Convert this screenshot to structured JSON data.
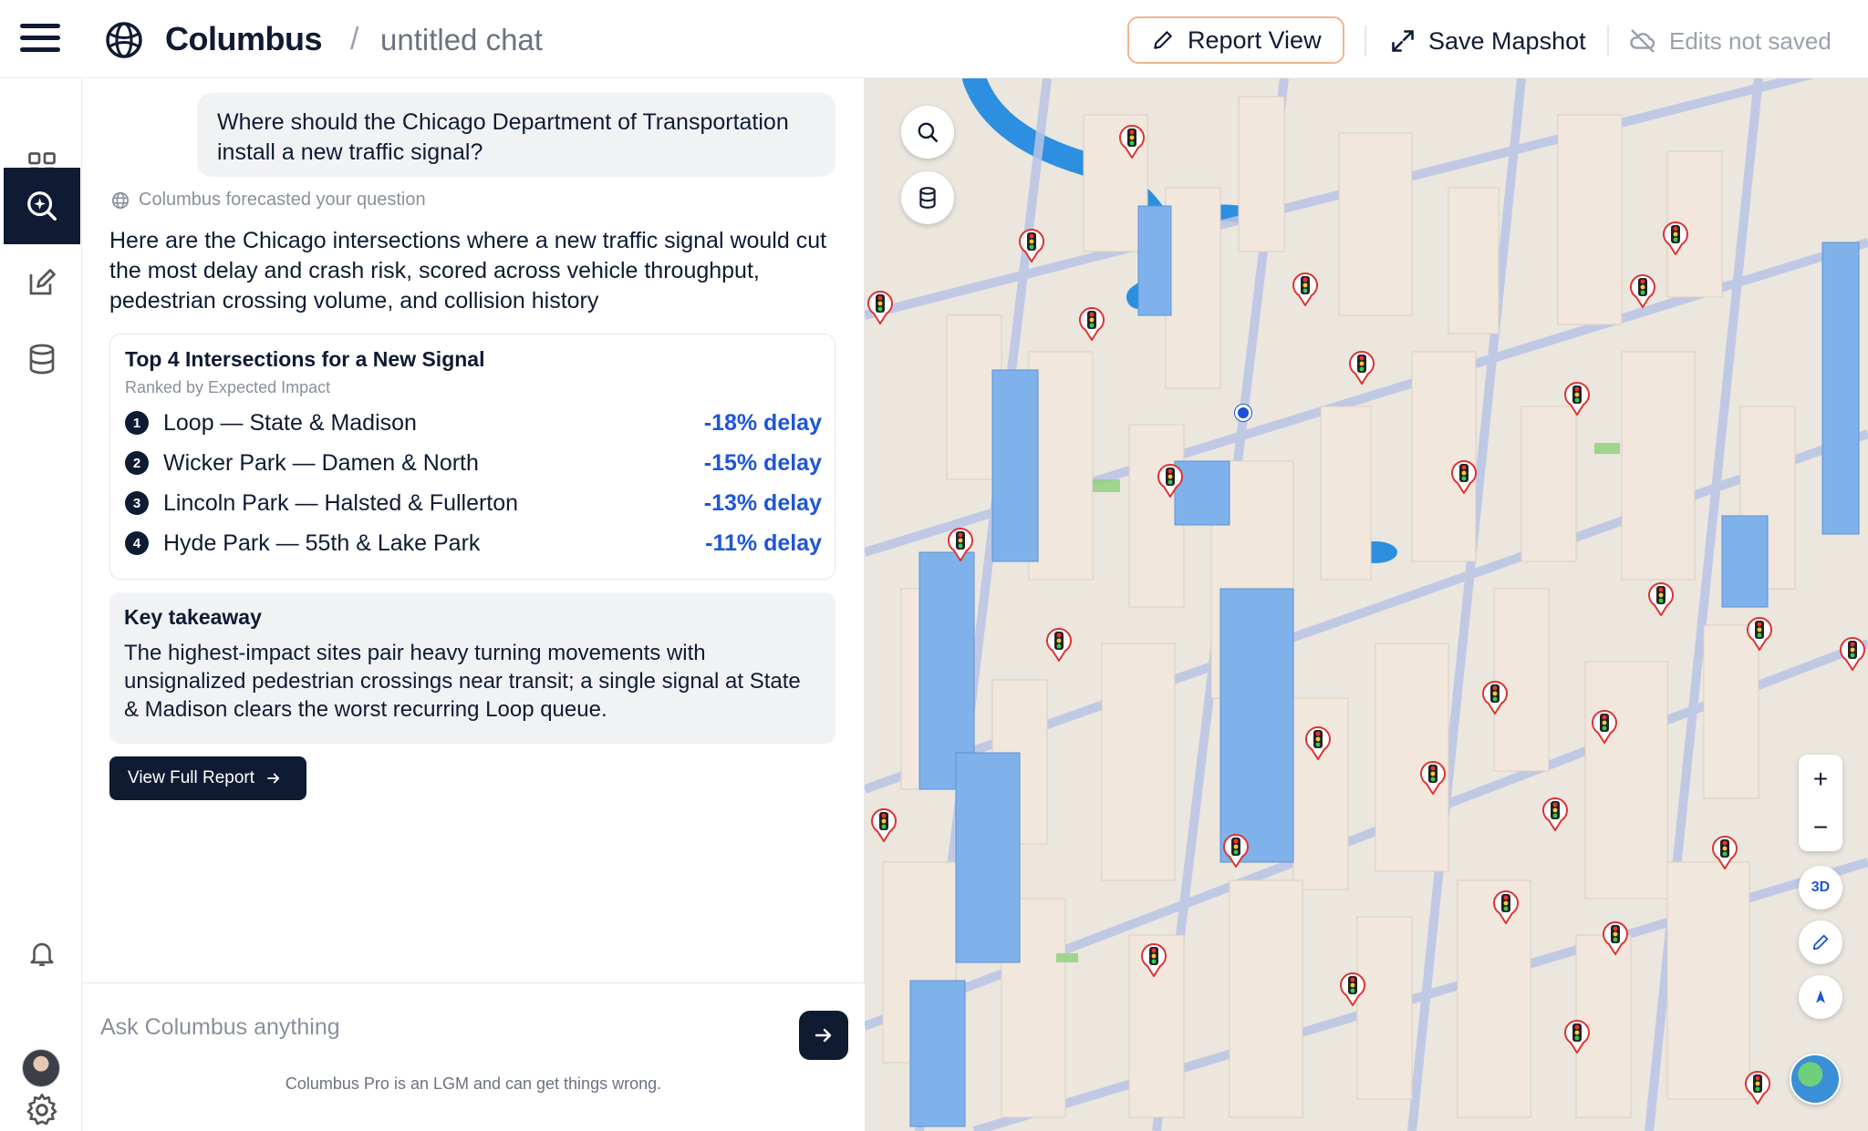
{
  "app": {
    "name": "Columbus",
    "separator": "/",
    "chat_title": "untitled chat"
  },
  "toolbar": {
    "report_view": "Report View",
    "save_mapshot": "Save Mapshot",
    "edits_status": "Edits not saved"
  },
  "chat": {
    "user_question": "Where should the Chicago Department of Transportation install a new traffic signal?",
    "forecast_note": "Columbus forecasted your question",
    "answer": "Here are the Chicago intersections where a new traffic signal would cut the most delay and crash risk, scored across vehicle throughput, pedestrian crossing volume, and collision history",
    "card": {
      "title": "Top 4 Intersections for a New Signal",
      "subtitle": "Ranked by Expected Impact",
      "rows": [
        {
          "rank": "1",
          "label": "Loop — State & Madison",
          "delay": "-18% delay"
        },
        {
          "rank": "2",
          "label": "Wicker Park — Damen & North",
          "delay": "-15% delay"
        },
        {
          "rank": "3",
          "label": "Lincoln Park — Halsted & Fullerton",
          "delay": "-13% delay"
        },
        {
          "rank": "4",
          "label": "Hyde Park — 55th & Lake Park",
          "delay": "-11% delay"
        }
      ]
    },
    "takeaway": {
      "title": "Key takeaway",
      "body": "The highest-impact sites pair heavy turning movements with unsignalized pedestrian crossings near transit; a single signal at State & Madison clears the worst recurring Loop queue."
    },
    "cta": "View Full Report",
    "composer_placeholder": "Ask Columbus anything",
    "disclaimer": "Columbus Pro is an LGM and can get things wrong."
  },
  "map": {
    "zoom_in": "+",
    "zoom_out": "−",
    "mode_3d": "3D"
  },
  "colors": {
    "navy": "#0f1b33",
    "accent_blue": "#1f56d6",
    "report_border": "#f2b48a",
    "water": "#2c8fe0"
  },
  "icons": {
    "menu": "hamburger-icon",
    "logo": "globe-logo-icon",
    "report": "pencil-icon",
    "mapshot": "expand-icon",
    "edits": "cloud-off-icon",
    "rail": [
      "grid-icon",
      "search-sparkle-icon",
      "edit-icon",
      "database-icon",
      "bell-icon",
      "gear-icon"
    ],
    "map_tools": [
      "search-icon",
      "database-icon",
      "pencil-icon",
      "compass-icon"
    ]
  }
}
